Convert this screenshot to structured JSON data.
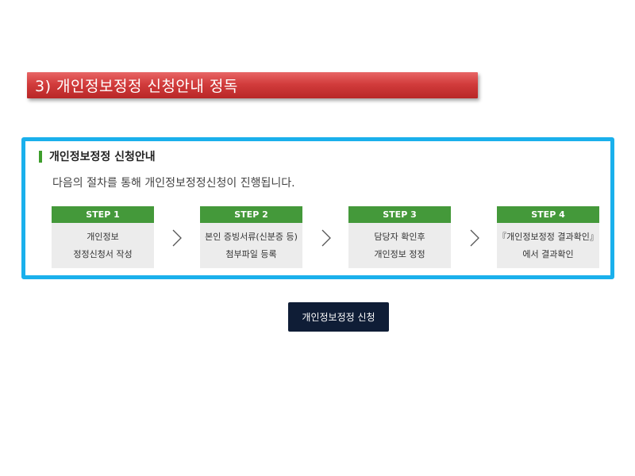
{
  "section": {
    "title": "3) 개인정보정정 신청안내 정독"
  },
  "panel": {
    "heading": "개인정보정정 신청안내",
    "description": "다음의 절차를 통해 개인정보정정신청이 진행됩니다.",
    "steps": [
      {
        "label": "STEP 1",
        "lines": [
          "개인정보",
          "정정신청서 작성"
        ]
      },
      {
        "label": "STEP 2",
        "lines": [
          "본인 증빙서류(신분증 등)",
          "첨부파일 등록"
        ]
      },
      {
        "label": "STEP 3",
        "lines": [
          "담당자 확인후",
          "개인정보 정정"
        ]
      },
      {
        "label": "STEP 4",
        "lines": [
          "『개인정보정정 결과확인』",
          "에서 결과확인"
        ]
      }
    ]
  },
  "apply_button": {
    "label": "개인정보정정 신청"
  },
  "colors": {
    "banner": "#d23c3c",
    "panel_border": "#1ab0ec",
    "step_header": "#44993a",
    "heading_bar": "#3e9e2c",
    "button": "#0f1d36"
  },
  "icons": {
    "step_separator": "chevron-right-icon"
  }
}
